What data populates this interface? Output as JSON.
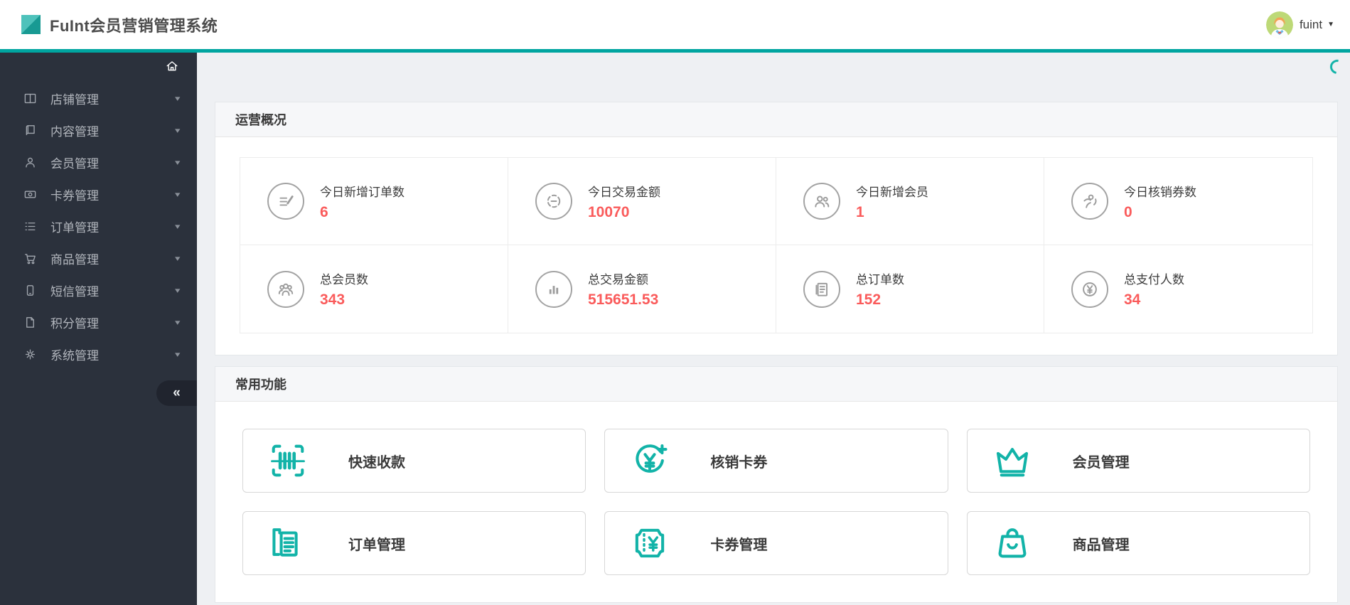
{
  "header": {
    "title": "FuInt会员营销管理系统",
    "user": "fuint",
    "logo_icon": "logo-diamond-icon",
    "avatar_icon": "user-avatar-icon",
    "caret_icon": "chevron-down-icon"
  },
  "sidebar": {
    "home_icon": "home-icon",
    "collapse_label": "«",
    "items": [
      {
        "label": "店铺管理",
        "icon": "store-icon"
      },
      {
        "label": "内容管理",
        "icon": "content-book-icon"
      },
      {
        "label": "会员管理",
        "icon": "member-user-icon"
      },
      {
        "label": "卡券管理",
        "icon": "coupon-banknote-icon"
      },
      {
        "label": "订单管理",
        "icon": "order-list-icon"
      },
      {
        "label": "商品管理",
        "icon": "goods-cart-icon"
      },
      {
        "label": "短信管理",
        "icon": "sms-phone-icon"
      },
      {
        "label": "积分管理",
        "icon": "points-file-icon"
      },
      {
        "label": "系统管理",
        "icon": "system-gear-icon"
      }
    ]
  },
  "overview": {
    "title": "运营概况",
    "stats": [
      {
        "label": "今日新增订单数",
        "value": "6",
        "icon": "order-new-icon"
      },
      {
        "label": "今日交易金额",
        "value": "10070",
        "icon": "transaction-today-icon"
      },
      {
        "label": "今日新增会员",
        "value": "1",
        "icon": "member-new-icon"
      },
      {
        "label": "今日核销券数",
        "value": "0",
        "icon": "coupon-verified-icon"
      },
      {
        "label": "总会员数",
        "value": "343",
        "icon": "members-total-icon"
      },
      {
        "label": "总交易金额",
        "value": "515651.53",
        "icon": "transaction-total-icon"
      },
      {
        "label": "总订单数",
        "value": "152",
        "icon": "orders-total-icon"
      },
      {
        "label": "总支付人数",
        "value": "34",
        "icon": "payers-total-icon"
      }
    ]
  },
  "functions": {
    "title": "常用功能",
    "items": [
      {
        "label": "快速收款",
        "icon": "scan-barcode-icon"
      },
      {
        "label": "核销卡券",
        "icon": "verify-coupon-icon"
      },
      {
        "label": "会员管理",
        "icon": "member-crown-icon"
      },
      {
        "label": "订单管理",
        "icon": "order-docs-icon"
      },
      {
        "label": "卡券管理",
        "icon": "coupon-ticket-icon"
      },
      {
        "label": "商品管理",
        "icon": "goods-bag-icon"
      }
    ]
  },
  "colors": {
    "teal_accent": "#12b3a8",
    "header_border": "#00a5a0",
    "value_red": "#fa5b5b",
    "sidebar_bg": "#2b313c",
    "page_bg": "#eef0f3"
  }
}
